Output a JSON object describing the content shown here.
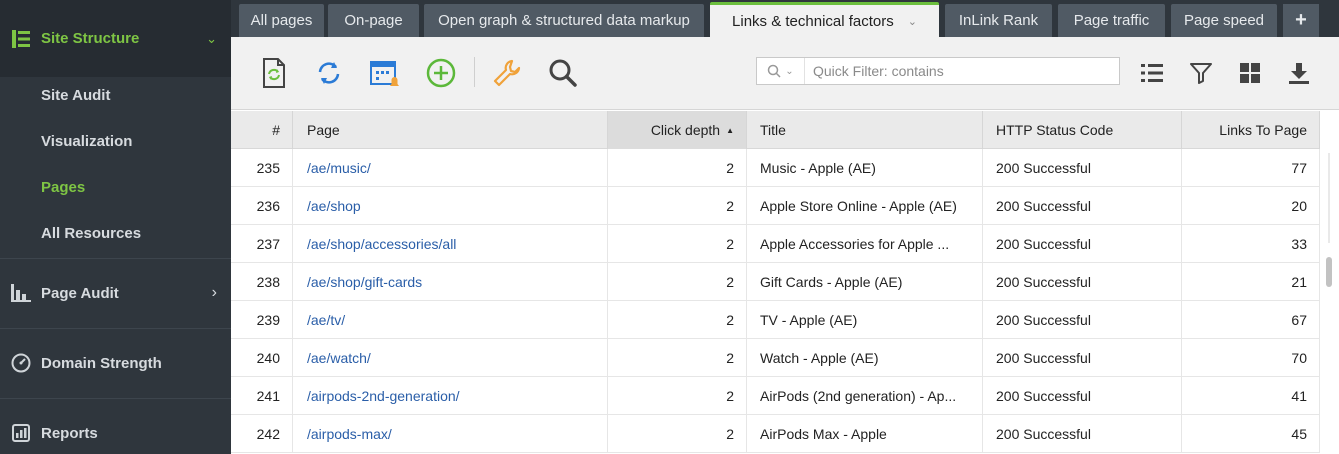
{
  "sidebar": {
    "site_structure": "Site Structure",
    "sub_items": [
      "Site Audit",
      "Visualization",
      "Pages",
      "All Resources"
    ],
    "active_sub": "Pages",
    "page_audit": "Page Audit",
    "domain_strength": "Domain Strength",
    "reports": "Reports"
  },
  "tabs": [
    "All pages",
    "On-page",
    "Open graph & structured data markup",
    "Links & technical factors",
    "InLink Rank",
    "Page traffic",
    "Page speed"
  ],
  "active_tab": "Links & technical factors",
  "tab_plus": "+",
  "toolbar": {
    "filter_placeholder": "Quick Filter: contains"
  },
  "table": {
    "columns": [
      "#",
      "Page",
      "Click depth",
      "Title",
      "HTTP Status Code",
      "Links To Page"
    ],
    "sort_indicator": "▲",
    "rows": [
      {
        "num": "235",
        "page": "/ae/music/",
        "depth": "2",
        "title": "Music - Apple (AE)",
        "status": "200 Successful",
        "links": "77"
      },
      {
        "num": "236",
        "page": "/ae/shop",
        "depth": "2",
        "title": "Apple Store Online - Apple (AE)",
        "status": "200 Successful",
        "links": "20"
      },
      {
        "num": "237",
        "page": "/ae/shop/accessories/all",
        "depth": "2",
        "title": "Apple Accessories for Apple ...",
        "status": "200 Successful",
        "links": "33"
      },
      {
        "num": "238",
        "page": "/ae/shop/gift-cards",
        "depth": "2",
        "title": "Gift Cards - Apple (AE)",
        "status": "200 Successful",
        "links": "21"
      },
      {
        "num": "239",
        "page": "/ae/tv/",
        "depth": "2",
        "title": "TV - Apple (AE)",
        "status": "200 Successful",
        "links": "67"
      },
      {
        "num": "240",
        "page": "/ae/watch/",
        "depth": "2",
        "title": "Watch - Apple (AE)",
        "status": "200 Successful",
        "links": "70"
      },
      {
        "num": "241",
        "page": "/airpods-2nd-generation/",
        "depth": "2",
        "title": "AirPods (2nd generation) - Ap...",
        "status": "200 Successful",
        "links": "41"
      },
      {
        "num": "242",
        "page": "/airpods-max/",
        "depth": "2",
        "title": "AirPods Max - Apple",
        "status": "200 Successful",
        "links": "45"
      }
    ]
  },
  "colors": {
    "accent_green": "#7ec544",
    "link_blue": "#2a5ea8",
    "sidebar_bg": "#2f363d"
  }
}
